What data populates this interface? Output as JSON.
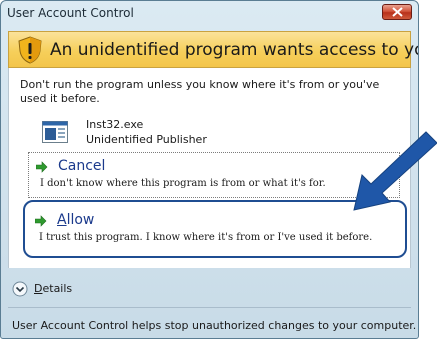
{
  "window": {
    "title": "User Account Control"
  },
  "banner": {
    "text": "An unidentified program wants access to your computer"
  },
  "content": {
    "description": "Don't run the program unless you know where it's from or you've used it before.",
    "program_name": "Inst32.exe",
    "publisher": "Unidentified Publisher"
  },
  "options": {
    "cancel": {
      "title": "Cancel",
      "description": "I don't know where this program is from or what it's for."
    },
    "allow": {
      "title_accel": "A",
      "title_rest": "llow",
      "description": "I trust this program. I know where it's from or I've used it before."
    }
  },
  "details": {
    "label_accel": "D",
    "label_rest": "etails"
  },
  "footer": {
    "text": "User Account Control helps stop unauthorized changes to your computer."
  },
  "icons": {
    "shield": "uac-shield-icon",
    "program": "program-icon",
    "arrow": "green-arrow-icon",
    "details": "chevron-down-icon",
    "pointer": "blue-pointer-arrow"
  },
  "colors": {
    "banner": "#f6cf5b",
    "option_link": "#1b3a8c",
    "highlight": "#1f4d92",
    "close": "#c43e24"
  }
}
